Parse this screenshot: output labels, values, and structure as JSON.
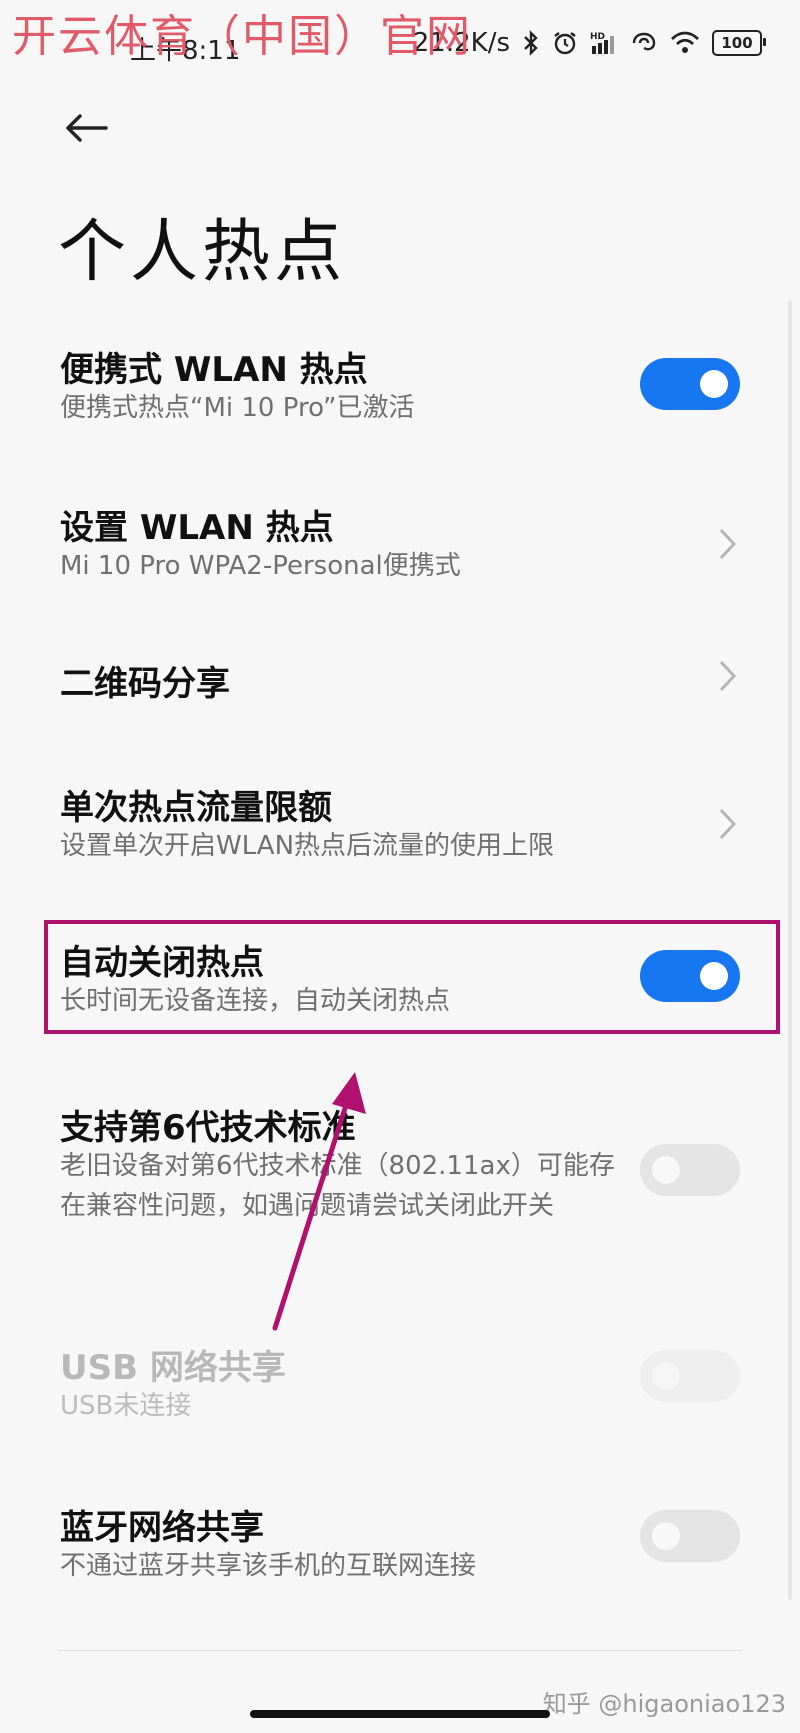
{
  "watermark": "开云体育（中国）官网",
  "status_bar": {
    "time": "上午8:11",
    "net_speed": "21.2K/s",
    "battery": "100"
  },
  "header": {
    "title": "个人热点"
  },
  "settings": [
    {
      "title": "便携式 WLAN 热点",
      "subtitle": "便携式热点“Mi 10 Pro”已激活",
      "control": "toggle",
      "state": "on"
    },
    {
      "title": "设置 WLAN 热点",
      "subtitle": "Mi 10 Pro WPA2-Personal便携式",
      "control": "chevron"
    },
    {
      "title": "二维码分享",
      "subtitle": "",
      "control": "chevron"
    },
    {
      "title": "单次热点流量限额",
      "subtitle": "设置单次开启WLAN热点后流量的使用上限",
      "control": "chevron"
    },
    {
      "title": "自动关闭热点",
      "subtitle": "长时间无设备连接，自动关闭热点",
      "control": "toggle",
      "state": "on"
    },
    {
      "title": "支持第6代技术标准",
      "subtitle": "老旧设备对第6代技术标准（802.11ax）可能存在兼容性问题，如遇问题请尝试关闭此开关",
      "control": "toggle",
      "state": "off"
    },
    {
      "title": "USB 网络共享",
      "subtitle": "USB未连接",
      "control": "toggle",
      "state": "off",
      "disabled": true
    },
    {
      "title": "蓝牙网络共享",
      "subtitle": "不通过蓝牙共享该手机的互联网连接",
      "control": "toggle",
      "state": "off"
    }
  ],
  "credit": "知乎 @higaoniao123",
  "colors": {
    "accent": "#1677f0",
    "highlight_box": "#b0106e",
    "arrow": "#b0106e",
    "watermark": "#e05a6a"
  },
  "icons": [
    "back-arrow-icon",
    "bluetooth-icon",
    "alarm-icon",
    "hd-signal-icon",
    "hotspot-icon",
    "wifi-icon",
    "battery-icon",
    "chevron-right-icon"
  ]
}
